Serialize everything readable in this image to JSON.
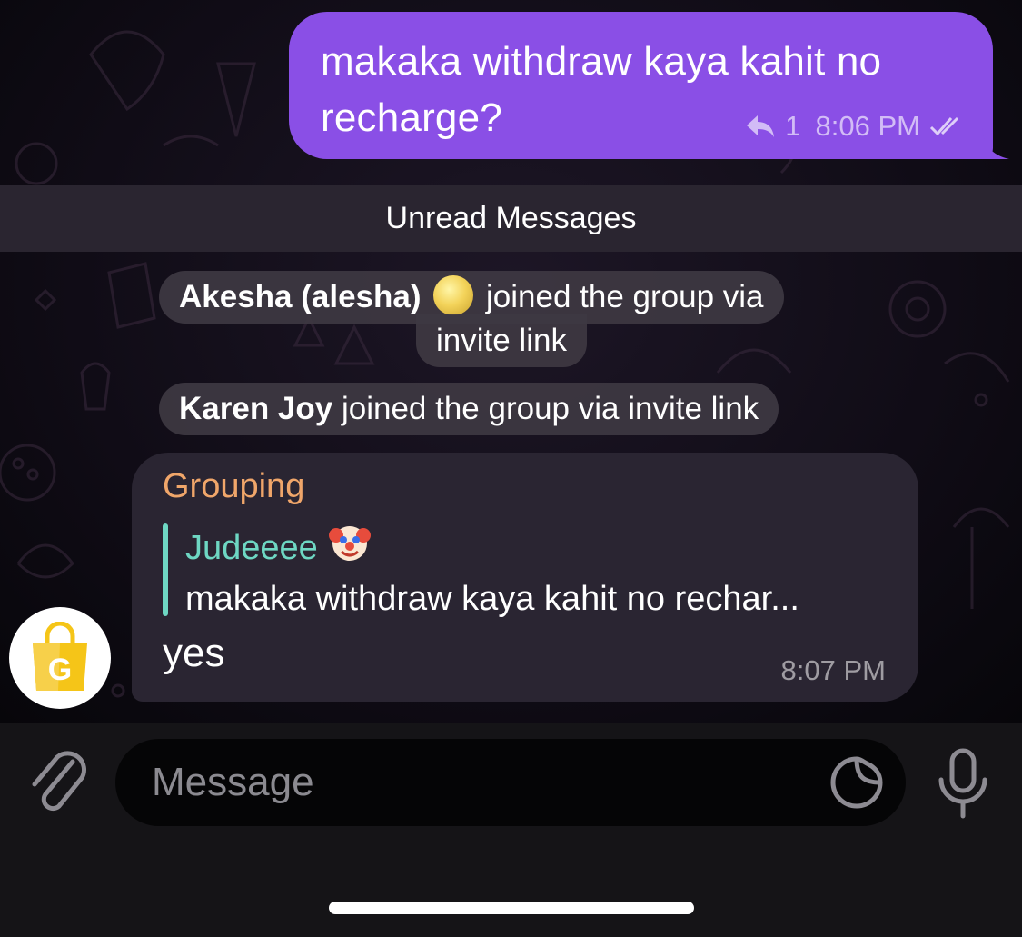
{
  "colors": {
    "outgoing_bubble": "#8a4fe6",
    "incoming_bubble": "#2a2532",
    "sender_name": "#f0a66a",
    "reply_accent": "#6ed7c3",
    "unread_bar": "#2a2530",
    "input_bar": "#151417"
  },
  "outgoing_message": {
    "text": "makaka withdraw kaya kahit no recharge?",
    "reply_count": "1",
    "time": "8:06 PM",
    "status_icon": "double-check-icon"
  },
  "unread_divider": {
    "label": "Unread Messages"
  },
  "service_messages": [
    {
      "name": "Akesha (alesha)",
      "emoji": "full-moon-emoji",
      "line1_suffix": "joined the group via",
      "line2": "invite link"
    },
    {
      "name": "Karen Joy",
      "text": "joined the group via invite link"
    }
  ],
  "incoming_message": {
    "sender": "Grouping",
    "reply_to": {
      "name": "Judeeee",
      "emoji": "clown-face-emoji",
      "text": "makaka withdraw kaya kahit no rechar..."
    },
    "text": "yes",
    "time": "8:07 PM",
    "avatar": {
      "icon": "shopping-bag-icon",
      "letter": "G",
      "color": "#f5c518"
    }
  },
  "composer": {
    "placeholder": "Message",
    "attach_icon": "paperclip-icon",
    "sticker_icon": "sticker-icon",
    "mic_icon": "microphone-icon"
  }
}
